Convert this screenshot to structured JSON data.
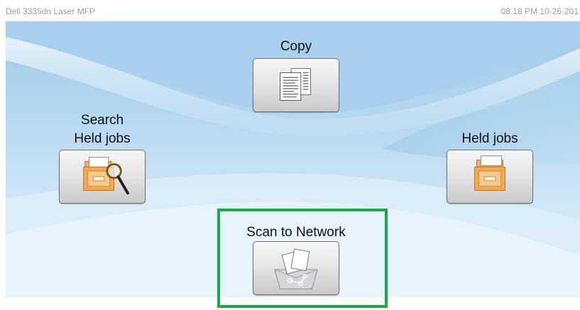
{
  "header": {
    "device_name": "Dell 3335dn Laser MFP",
    "datetime": "08:18 PM 10-26-201"
  },
  "tiles": {
    "copy": {
      "label": "Copy",
      "icon": "copy-documents-icon"
    },
    "search_held_jobs": {
      "label_line1": "Search",
      "label_line2": "Held jobs",
      "icon": "search-held-jobs-icon"
    },
    "held_jobs": {
      "label": "Held jobs",
      "icon": "held-jobs-folder-icon"
    },
    "scan_to_network": {
      "label": "Scan to Network",
      "icon": "scan-to-network-icon"
    }
  },
  "focus": {
    "selected_tile": "Scan to Network",
    "color": "#1aa84a"
  },
  "colors": {
    "background_blue": "#9fcae9",
    "text": "#111111"
  }
}
